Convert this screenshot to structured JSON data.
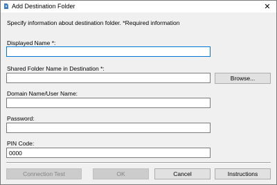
{
  "window": {
    "title": "Add Destination Folder",
    "close_glyph": "✕"
  },
  "intro": "Specify information about destination folder. *Required information",
  "fields": {
    "displayed_name": {
      "label": "Displayed Name *:",
      "value": ""
    },
    "shared_folder": {
      "label": "Shared Folder Name in Destination *:",
      "value": ""
    },
    "domain_user": {
      "label": "Domain Name/User Name:",
      "value": ""
    },
    "password": {
      "label": "Password:",
      "value": ""
    },
    "pin": {
      "label": "PIN Code:",
      "value": "0000"
    }
  },
  "buttons": {
    "browse": "Browse...",
    "connection_test": "Connection Test",
    "ok": "OK",
    "cancel": "Cancel",
    "instructions": "Instructions"
  },
  "icons": {
    "app_icon": "app-icon",
    "close_icon": "close-icon"
  },
  "colors": {
    "focus_border": "#0078d7",
    "app_icon": "#3d7fc1"
  }
}
